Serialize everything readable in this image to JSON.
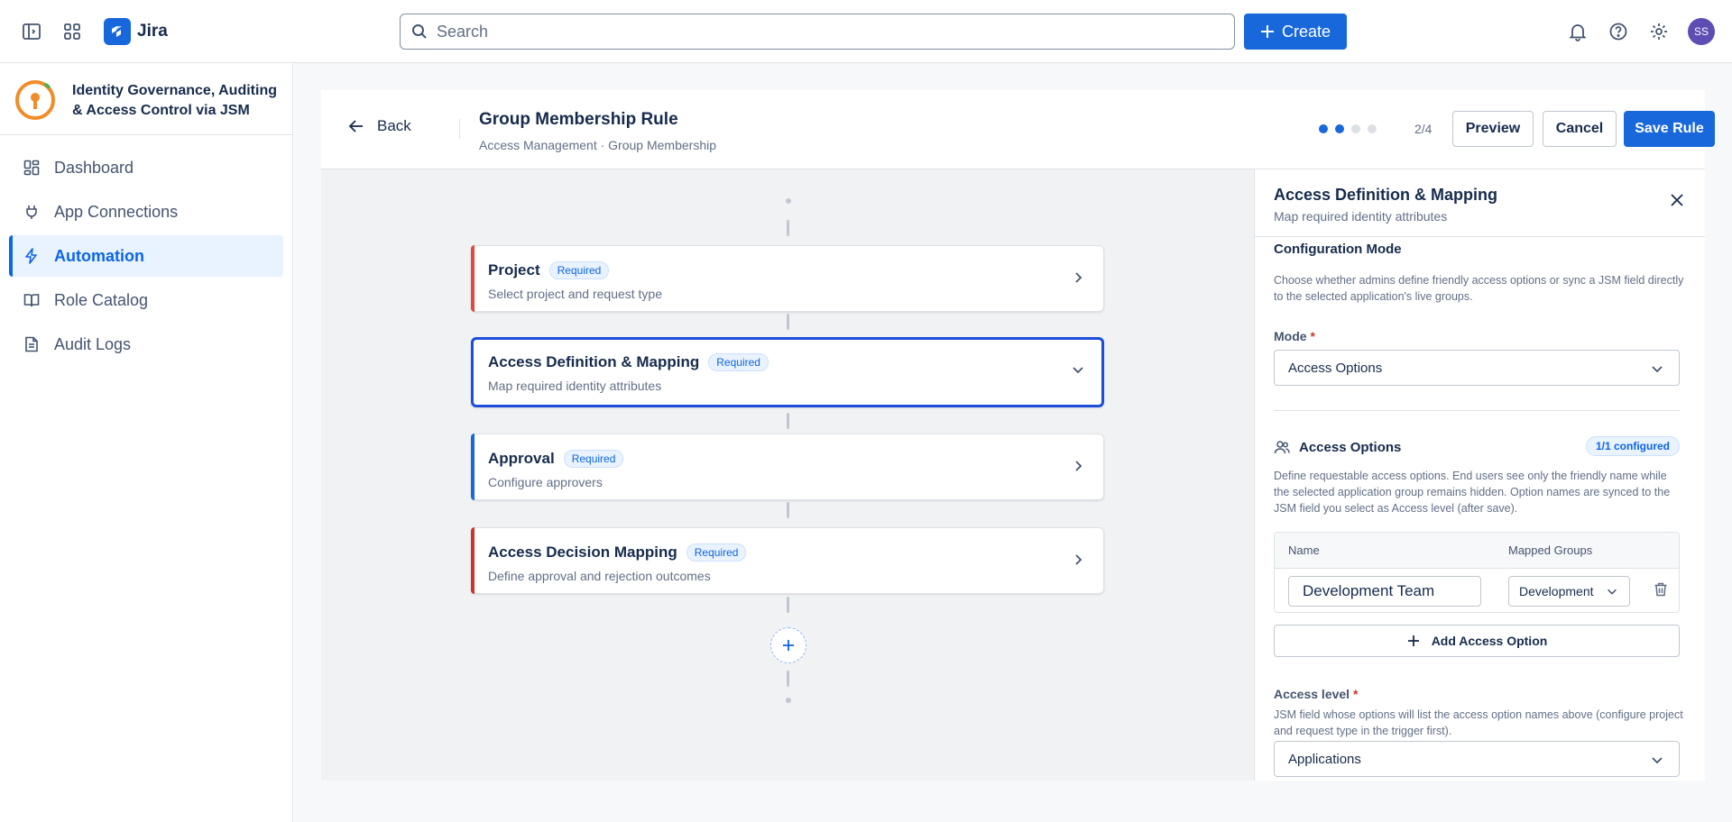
{
  "topbar": {
    "app_name": "Jira",
    "search_placeholder": "Search",
    "create_label": "Create",
    "avatar_initials": "SS"
  },
  "sidebar": {
    "app_title": "Identity Governance, Auditing & Access Control via JSM",
    "items": [
      {
        "label": "Dashboard",
        "icon": "dashboard-icon"
      },
      {
        "label": "App Connections",
        "icon": "plug-icon"
      },
      {
        "label": "Automation",
        "icon": "lightning-icon",
        "active": true
      },
      {
        "label": "Role Catalog",
        "icon": "book-icon"
      },
      {
        "label": "Audit Logs",
        "icon": "document-icon"
      }
    ]
  },
  "rule": {
    "back_label": "Back",
    "title": "Group Membership Rule",
    "subtitle": "Access Management · Group Membership",
    "step_text": "2/4",
    "preview_label": "Preview",
    "cancel_label": "Cancel",
    "save_label": "Save Rule"
  },
  "flow": {
    "cards": [
      {
        "title": "Project",
        "badge": "Required",
        "subtitle": "Select project and request type",
        "accent": "#e2483d"
      },
      {
        "title": "Access Definition & Mapping",
        "badge": "Required",
        "subtitle": "Map required identity attributes",
        "accent": "#1d4ed8"
      },
      {
        "title": "Approval",
        "badge": "Required",
        "subtitle": "Configure approvers",
        "accent": "#1868db"
      },
      {
        "title": "Access Decision Mapping",
        "badge": "Required",
        "subtitle": "Define approval and rejection outcomes",
        "accent": "#c9372c"
      }
    ]
  },
  "panel": {
    "title": "Access Definition & Mapping",
    "subtitle": "Map required identity attributes",
    "config_mode_title": "Configuration Mode",
    "config_mode_help": "Choose whether admins define friendly access options or sync a JSM field directly to the selected application's live groups.",
    "mode_label": "Mode",
    "required_mark": "*",
    "mode_value": "Access Options",
    "access_options_title": "Access Options",
    "configured_badge": "1/1 configured",
    "access_options_help": "Define requestable access options. End users see only the friendly name while the selected application group remains hidden. Option names are synced to the JSM field you select as Access level (after save).",
    "table": {
      "col_name": "Name",
      "col_groups": "Mapped Groups",
      "rows": [
        {
          "name": "Development Team",
          "group": "Development"
        }
      ]
    },
    "add_option_label": "Add Access Option",
    "access_level_label": "Access level",
    "access_level_help": "JSM field whose options will list the access option names above (configure project and request type in the trigger first).",
    "access_level_value": "Applications"
  },
  "colors": {
    "brand": "#1868db",
    "selected_border": "#1d4ed8",
    "avatar": "#5e4db2"
  }
}
